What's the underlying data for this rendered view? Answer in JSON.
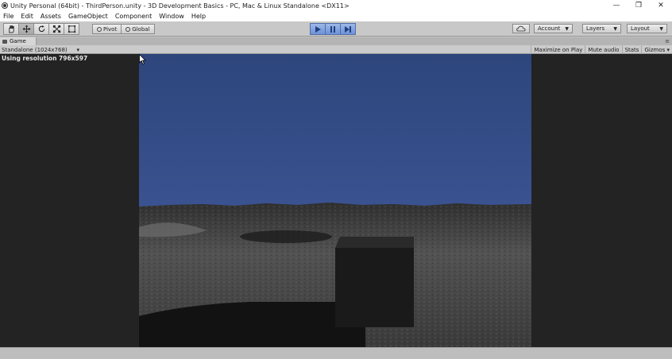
{
  "window": {
    "title": "Unity Personal (64bit) - ThirdPerson.unity - 3D Development Basics - PC, Mac & Linux Standalone <DX11>",
    "controls": {
      "minimize": "—",
      "restore": "❐",
      "close": "✕"
    }
  },
  "menubar": {
    "items": [
      "File",
      "Edit",
      "Assets",
      "GameObject",
      "Component",
      "Window",
      "Help"
    ]
  },
  "toolbar": {
    "transform_tools": [
      "hand-tool",
      "move-tool",
      "rotate-tool",
      "scale-tool",
      "rect-tool"
    ],
    "pivot_label": "Pivot",
    "global_label": "Global",
    "account_label": "Account",
    "layers_label": "Layers",
    "layout_label": "Layout",
    "play_accent": "#6e92d6"
  },
  "game_panel": {
    "tab_label": "Game",
    "resolution_select": "Standalone (1024x768)",
    "toggles": [
      "Maximize on Play",
      "Mute audio",
      "Stats",
      "Gizmos"
    ],
    "resolution_note": "Using resolution 796x597"
  },
  "scene": {
    "sky_color": "#324a80",
    "ground_color": "#4a4a4a",
    "cube_color": "#1a1a1a"
  }
}
